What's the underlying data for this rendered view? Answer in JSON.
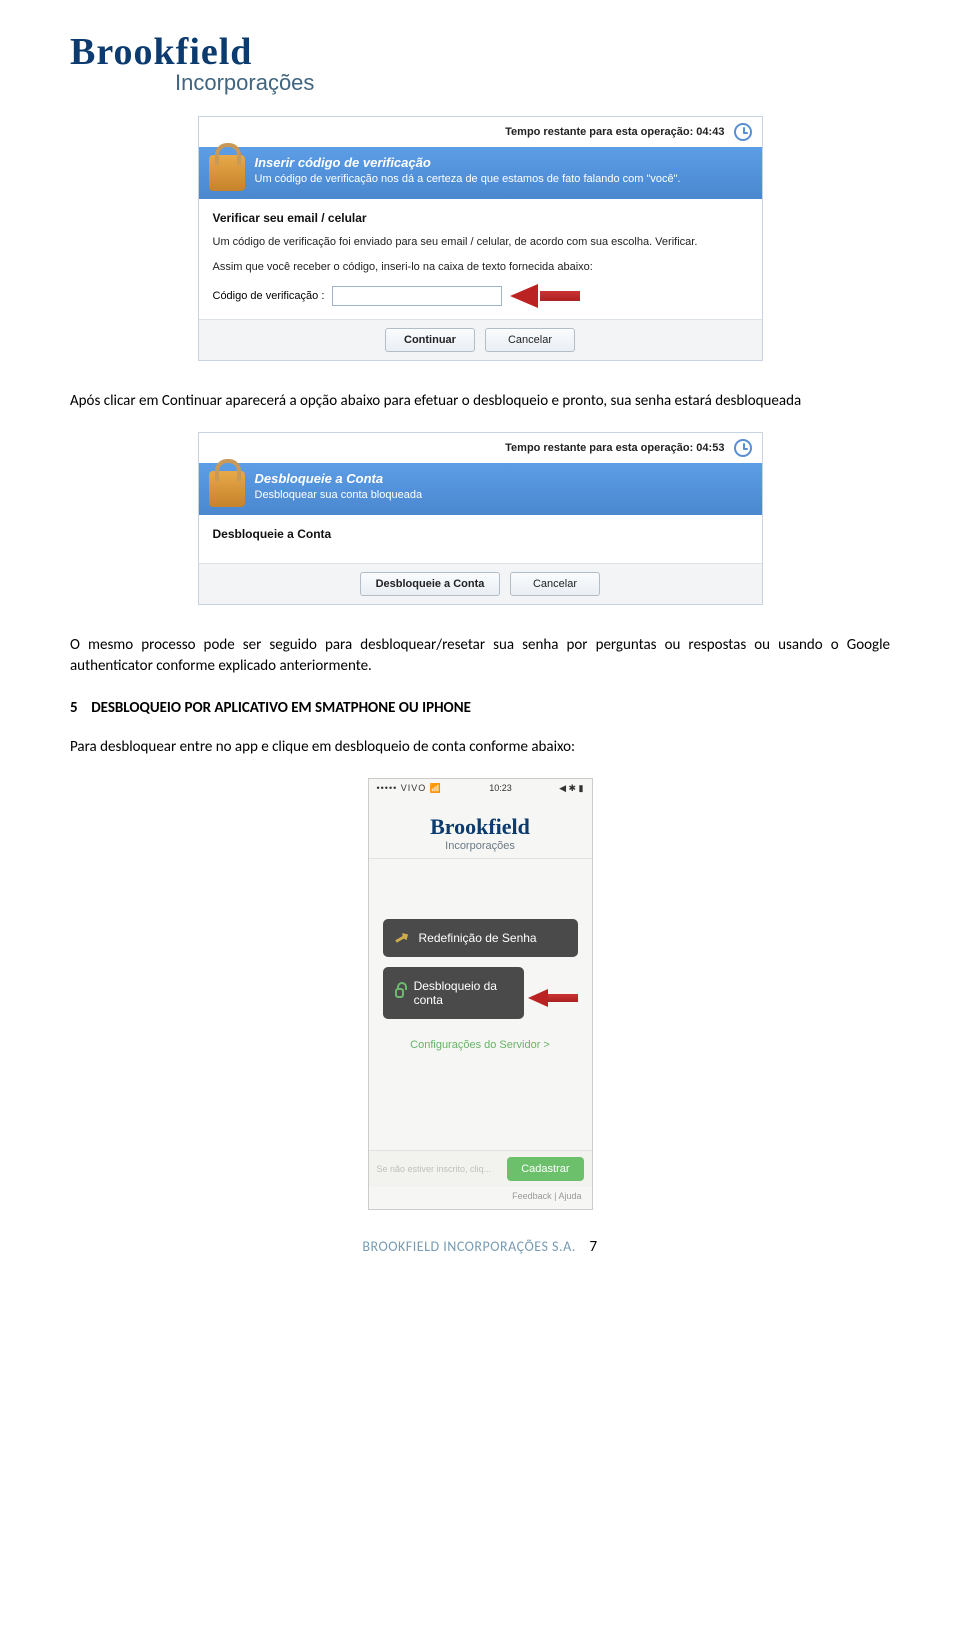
{
  "logo": {
    "main": "Brookfield",
    "sub": "Incorporações"
  },
  "dialog1": {
    "timer_label": "Tempo restante para esta operação: ",
    "timer_value": "04:43",
    "title": "Inserir código de verificação",
    "subtitle": "Um código de verificação nos dá a certeza de que estamos de fato falando com \"você\".",
    "section_title": "Verificar seu email / celular",
    "p1": "Um código de verificação foi enviado para seu email / celular, de acordo com sua escolha. Verificar.",
    "p2": "Assim que você receber o código, inseri-lo na caixa de texto fornecida abaixo:",
    "input_label": "Código de verificação :",
    "btn_continue": "Continuar",
    "btn_cancel": "Cancelar"
  },
  "text1": "Após clicar em Continuar aparecerá a opção abaixo para efetuar o desbloqueio e pronto, sua senha estará desbloqueada",
  "dialog2": {
    "timer_label": "Tempo restante para esta operação: ",
    "timer_value": "04:53",
    "title": "Desbloqueie a Conta",
    "subtitle": "Desbloquear sua conta bloqueada",
    "section_title": "Desbloqueie a Conta",
    "btn_primary": "Desbloqueie a Conta",
    "btn_cancel": "Cancelar"
  },
  "text2": "O mesmo processo pode ser seguido para desbloquear/resetar sua senha por perguntas ou respostas ou usando o Google authenticator conforme explicado anteriormente.",
  "section5": {
    "num": "5",
    "title": "DESBLOQUEIO POR APLICATIVO EM SMATPHONE OU IPHONE"
  },
  "text3": "Para desbloquear entre no app e clique em desbloqueio de conta conforme abaixo:",
  "phone": {
    "status_left": "••••• VIVO  📶",
    "status_center": "10:23",
    "status_right": "◀ ✱ ▮",
    "btn1": "Redefinição de Senha",
    "btn2": "Desbloqueio da conta",
    "config": "Configurações do Servidor >",
    "reg_text": "Se não estiver inscrito, cliq...",
    "reg_btn": "Cadastrar",
    "foot": "Feedback | Ajuda"
  },
  "footer": {
    "company": "BROOKFIELD INCORPORAÇÕES S.A.",
    "page": "7"
  }
}
